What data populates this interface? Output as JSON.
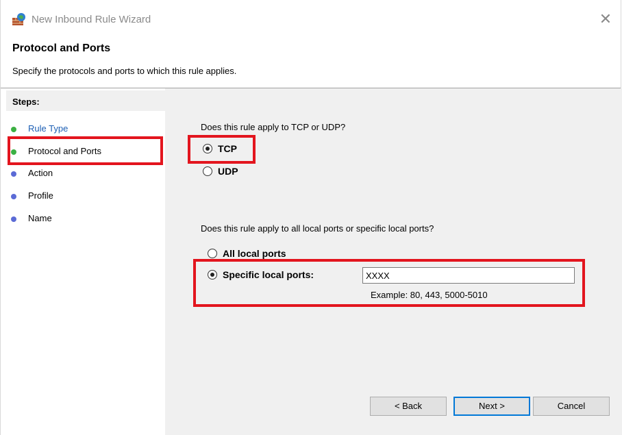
{
  "window": {
    "title": "New Inbound Rule Wizard",
    "close_symbol": "✕"
  },
  "header": {
    "title": "Protocol and Ports",
    "description": "Specify the protocols and ports to which this rule applies."
  },
  "steps": {
    "label": "Steps:",
    "items": [
      {
        "label": "Rule Type",
        "dot_color": "#3cb043"
      },
      {
        "label": "Protocol and Ports",
        "dot_color": "#3cb043"
      },
      {
        "label": "Action",
        "dot_color": "#5b6bd6"
      },
      {
        "label": "Profile",
        "dot_color": "#5b6bd6"
      },
      {
        "label": "Name",
        "dot_color": "#5b6bd6"
      }
    ]
  },
  "protocol": {
    "question": "Does this rule apply to TCP or UDP?",
    "options": [
      {
        "label": "TCP",
        "selected": true
      },
      {
        "label": "UDP",
        "selected": false
      }
    ]
  },
  "ports": {
    "question": "Does this rule apply to all local ports or specific local ports?",
    "options": [
      {
        "label": "All local ports",
        "selected": false
      },
      {
        "label": "Specific local ports:",
        "selected": true
      }
    ],
    "value": "XXXX",
    "example": "Example: 80, 443, 5000-5010"
  },
  "buttons": {
    "back": "< Back",
    "next": "Next >",
    "cancel": "Cancel"
  },
  "colors": {
    "highlight": "#e3151e",
    "link": "#1d5fb4",
    "default_button_border": "#0078d7"
  }
}
